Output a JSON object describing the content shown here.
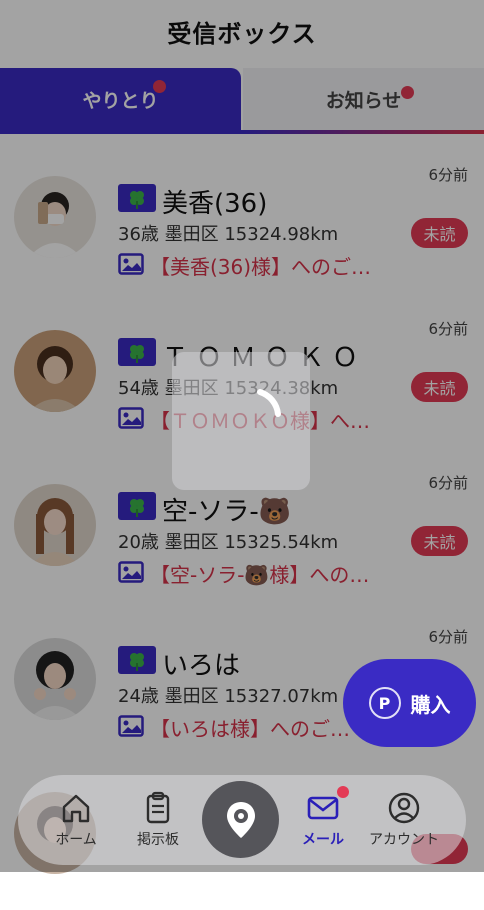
{
  "header": {
    "title": "受信ボックス"
  },
  "tabs": [
    {
      "label": "やりとり",
      "active": true,
      "has_badge": true
    },
    {
      "label": "お知らせ",
      "active": false,
      "has_badge": true
    }
  ],
  "messages": [
    {
      "name": "美香(36)",
      "meta": "36歳 墨田区 15324.98km",
      "preview": "【美香(36)様】へのご…",
      "time": "6分前",
      "badge": "未読"
    },
    {
      "name": "ＴＯＭＯＫＯ",
      "meta": "54歳 墨田区 15324.38km",
      "preview": "【ＴＯＭＯＫＯ様】へ…",
      "time": "6分前",
      "badge": "未読"
    },
    {
      "name": "空-ソラ-🐻",
      "meta": "20歳 墨田区 15325.54km",
      "preview": "【空-ソラ-🐻様】への…",
      "time": "6分前",
      "badge": "未読"
    },
    {
      "name": "いろは",
      "meta": "24歳 墨田区 15327.07km",
      "preview": "【いろは様】へのご…",
      "time": "6分前",
      "badge": ""
    }
  ],
  "buy_button": {
    "label": "購入",
    "icon": "P"
  },
  "bottom_nav": [
    {
      "label": "ホーム",
      "icon": "home-icon"
    },
    {
      "label": "掲示板",
      "icon": "board-icon"
    },
    {
      "label": "",
      "icon": "location-icon"
    },
    {
      "label": "メール",
      "icon": "mail-icon",
      "active": true,
      "has_badge": true
    },
    {
      "label": "アカウント",
      "icon": "account-icon"
    }
  ],
  "colors": {
    "primary": "#3a2bc4",
    "accent": "#e33a55",
    "overlay": "#000000"
  }
}
